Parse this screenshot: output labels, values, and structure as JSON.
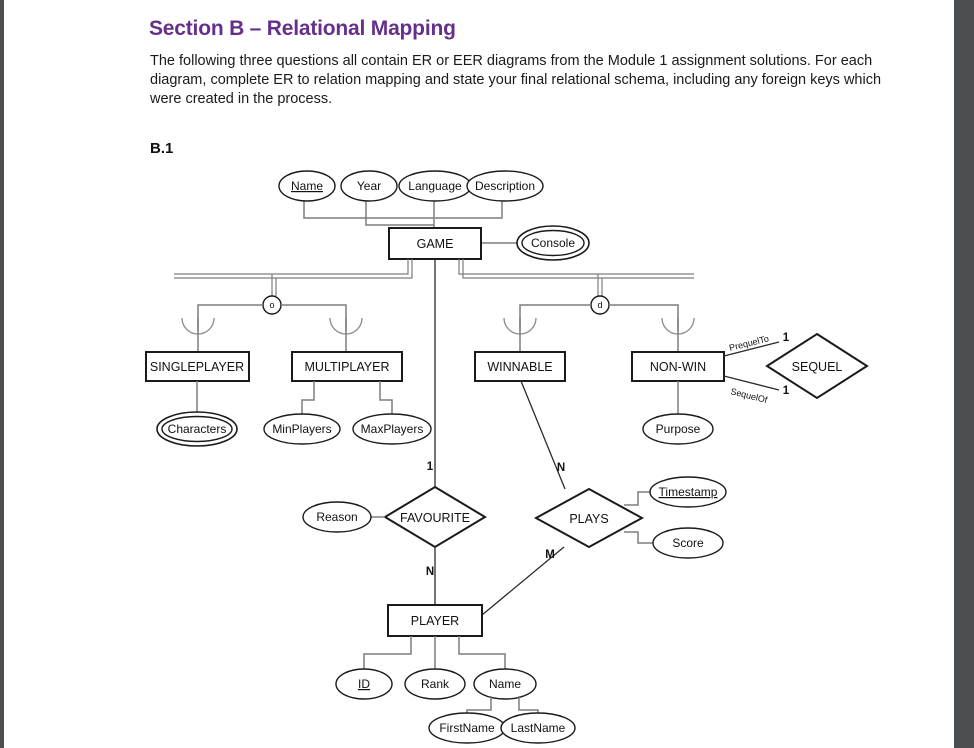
{
  "document": {
    "heading": "Section B – Relational Mapping",
    "intro": "The following three questions all contain ER or EER diagrams from the Module 1 assignment solutions. For each diagram, complete ER to relation mapping and state your final relational schema, including any foreign keys which were created in the process.",
    "section_label": "B.1",
    "heading_color": "#65308c"
  },
  "diagram": {
    "entities": {
      "game": "GAME",
      "singleplayer": "SINGLEPLAYER",
      "multiplayer": "MULTIPLAYER",
      "winnable": "WINNABLE",
      "nonwin": "NON-WIN",
      "player": "PLAYER"
    },
    "relationships": {
      "sequel": "SEQUEL",
      "favourite": "FAVOURITE",
      "plays": "PLAYS"
    },
    "attributes": {
      "name": "Name",
      "year": "Year",
      "language": "Language",
      "description": "Description",
      "console": "Console",
      "characters": "Characters",
      "minplayers": "MinPlayers",
      "maxplayers": "MaxPlayers",
      "purpose": "Purpose",
      "reason": "Reason",
      "timestamp": "Timestamp",
      "score": "Score",
      "id": "ID",
      "rank": "Rank",
      "player_name": "Name",
      "firstname": "FirstName",
      "lastname": "LastName"
    },
    "specialization": {
      "overlapping": "o",
      "disjoint": "d"
    },
    "roles": {
      "prequel_to": "PrequelTo",
      "sequel_of": "SequelOf"
    },
    "cardinalities": {
      "sequel_prequel": "1",
      "sequel_of": "1",
      "game_favourite": "1",
      "favourite_player": "N",
      "winnable_plays": "N",
      "plays_player": "M"
    }
  }
}
